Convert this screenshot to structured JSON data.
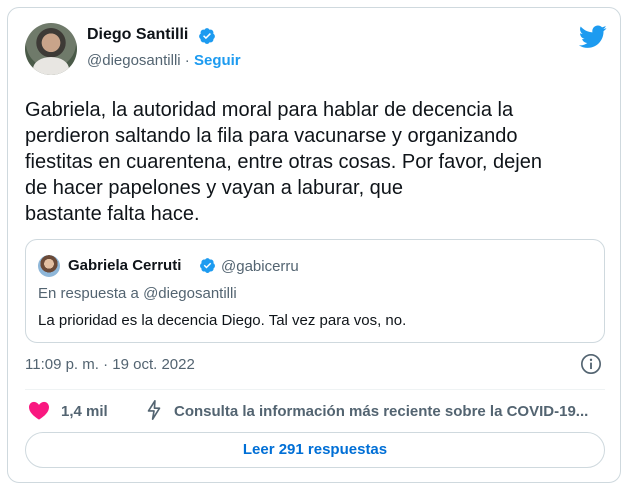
{
  "author": {
    "name": "Diego Santilli",
    "handle": "@diegosantilli",
    "separator": "·",
    "follow_label": "Seguir",
    "verified": true
  },
  "tweet": {
    "text_lines": [
      "Gabriela, la autoridad moral para hablar de decencia la",
      "perdieron saltando la fila para vacunarse y organizando",
      "fiestitas en cuarentena, entre otras cosas. Por favor, dejen",
      "de hacer papelones y vayan a laburar, que",
      "bastante falta hace."
    ],
    "timestamp": "11:09 p. m. · 19 oct. 2022"
  },
  "quoted": {
    "name": "Gabriela Cerruti",
    "handle": "@gabicerru",
    "reply_to": "En respuesta a @diegosantilli",
    "text": "La prioridad es la decencia Diego. Tal vez para vos, no."
  },
  "actions": {
    "likes": "1,4 mil",
    "covid_notice": "Consulta la información más reciente sobre la COVID-19...",
    "replies_button": "Leer 291 respuestas"
  },
  "icons": {
    "brand": "twitter-bird-icon",
    "verified": "verified-badge-icon",
    "info": "info-icon",
    "like": "heart-icon",
    "covid": "lightning-bolt-icon"
  },
  "colors": {
    "accent": "#1d9bf0",
    "heart": "#f91880",
    "muted_text": "#536471",
    "border": "#cfd9de",
    "link": "#006fd6"
  }
}
